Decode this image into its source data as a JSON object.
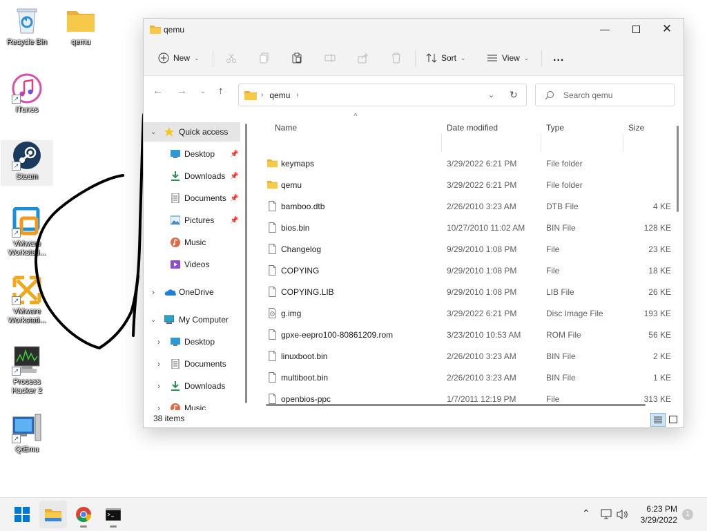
{
  "desktop": {
    "icons": [
      {
        "label": "Recycle Bin"
      },
      {
        "label": "qemu"
      },
      {
        "label": "iTunes"
      },
      {
        "label": "Steam"
      },
      {
        "label": "VMware Workstati..."
      },
      {
        "label": "VMware Workstati..."
      },
      {
        "label": "Process Hacker 2"
      },
      {
        "label": "QtEmu"
      }
    ]
  },
  "window": {
    "title": "qemu",
    "commands": {
      "new_label": "New",
      "sort_label": "Sort",
      "view_label": "View",
      "more_label": "..."
    },
    "address": {
      "crumb": "qemu",
      "search_placeholder": "Search qemu"
    },
    "nav": {
      "quick_access": "Quick access",
      "items": [
        {
          "label": "Desktop"
        },
        {
          "label": "Downloads"
        },
        {
          "label": "Documents"
        },
        {
          "label": "Pictures"
        },
        {
          "label": "Music"
        },
        {
          "label": "Videos"
        }
      ],
      "onedrive": "OneDrive",
      "my_computer": "My Computer",
      "computer_items": [
        {
          "label": "Desktop"
        },
        {
          "label": "Documents"
        },
        {
          "label": "Downloads"
        },
        {
          "label": "Music"
        }
      ]
    },
    "columns": {
      "name": "Name",
      "date": "Date modified",
      "type": "Type",
      "size": "Size"
    },
    "files": [
      {
        "name": "keymaps",
        "date": "3/29/2022 6:21 PM",
        "type": "File folder",
        "size": "",
        "kind": "folder"
      },
      {
        "name": "qemu",
        "date": "3/29/2022 6:21 PM",
        "type": "File folder",
        "size": "",
        "kind": "folder"
      },
      {
        "name": "bamboo.dtb",
        "date": "2/26/2010 3:23 AM",
        "type": "DTB File",
        "size": "4 KE",
        "kind": "file"
      },
      {
        "name": "bios.bin",
        "date": "10/27/2010 11:02 AM",
        "type": "BIN File",
        "size": "128 KE",
        "kind": "file"
      },
      {
        "name": "Changelog",
        "date": "9/29/2010 1:08 PM",
        "type": "File",
        "size": "23 KE",
        "kind": "file"
      },
      {
        "name": "COPYING",
        "date": "9/29/2010 1:08 PM",
        "type": "File",
        "size": "18 KE",
        "kind": "file"
      },
      {
        "name": "COPYING.LIB",
        "date": "9/29/2010 1:08 PM",
        "type": "LIB File",
        "size": "26 KE",
        "kind": "file"
      },
      {
        "name": "g.img",
        "date": "3/29/2022 6:21 PM",
        "type": "Disc Image File",
        "size": "193 KE",
        "kind": "image"
      },
      {
        "name": "gpxe-eepro100-80861209.rom",
        "date": "3/23/2010 10:53 AM",
        "type": "ROM File",
        "size": "56 KE",
        "kind": "file"
      },
      {
        "name": "linuxboot.bin",
        "date": "2/26/2010 3:23 AM",
        "type": "BIN File",
        "size": "2 KE",
        "kind": "file"
      },
      {
        "name": "multiboot.bin",
        "date": "2/26/2010 3:23 AM",
        "type": "BIN File",
        "size": "1 KE",
        "kind": "file"
      },
      {
        "name": "openbios-ppc",
        "date": "1/7/2011 12:19 PM",
        "type": "File",
        "size": "313 KE",
        "kind": "file"
      }
    ],
    "status": "38 items"
  },
  "taskbar": {
    "time": "6:23 PM",
    "date": "3/29/2022",
    "notification_count": "1"
  },
  "colors": {
    "accent": "#0067c0",
    "folder": "#f7c948",
    "chrome": "#f3f3f3"
  }
}
